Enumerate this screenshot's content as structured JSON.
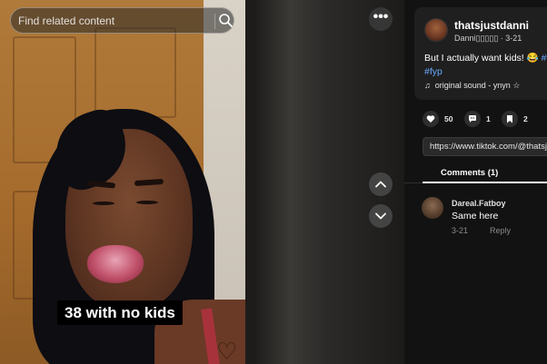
{
  "search": {
    "placeholder": "Find related content",
    "icon": "search-icon"
  },
  "video": {
    "caption": "38 with no kids",
    "more_label": "•••",
    "nav_up_icon": "chevron-up-icon",
    "nav_down_icon": "chevron-down-icon"
  },
  "post": {
    "username": "thatsjustdanni",
    "display_name": "Danni▯▯▯▯▯",
    "separator": " · ",
    "date": "3-21",
    "description": "But I actually want kids! 😂 ",
    "tags": [
      "#t",
      "#fyp"
    ],
    "sound_icon": "music-note-icon",
    "sound": "original sound - ynyn ☆"
  },
  "stats": {
    "likes": "50",
    "comments": "1",
    "saves": "2"
  },
  "share": {
    "url": "https://www.tiktok.com/@thatsjustdanni"
  },
  "tabs": {
    "comments_label": "Comments (1)"
  },
  "comments": [
    {
      "user": "Dareal.Fatboy",
      "text": "Same here",
      "date": "3-21",
      "reply_label": "Reply"
    }
  ],
  "colors": {
    "panel_bg": "#121212",
    "tag": "#6ba8ff",
    "caption_bg": "#000000"
  }
}
